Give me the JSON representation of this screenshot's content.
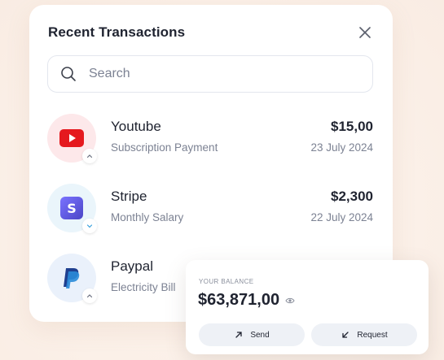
{
  "card": {
    "title": "Recent Transactions",
    "close_icon": "close-icon"
  },
  "search": {
    "placeholder": "Search",
    "value": "",
    "icon": "search-icon"
  },
  "transactions": [
    {
      "name": "Youtube",
      "description": "Subscription Payment",
      "amount": "$15,00",
      "date": "23 July 2024",
      "icon": "youtube-logo-icon",
      "direction": "up",
      "avatar_bg": "#fde8ea",
      "brand_color": "#e5191e"
    },
    {
      "name": "Stripe",
      "description": "Monthly Salary",
      "amount": "$2,300",
      "date": "22 July 2024",
      "icon": "stripe-logo-icon",
      "direction": "down",
      "avatar_bg": "#eaf5fb",
      "brand_color": "#6058dc"
    },
    {
      "name": "Paypal",
      "description": "Electricity Bill",
      "amount": "",
      "date": "",
      "icon": "paypal-logo-icon",
      "direction": "up",
      "avatar_bg": "#eaf1fb",
      "brand_color": "#1f3f8f"
    }
  ],
  "balance": {
    "label": "YOUR BALANCE",
    "amount": "$63,871,00",
    "eye_icon": "eye-icon",
    "send_label": "Send",
    "request_label": "Request"
  },
  "colors": {
    "background": "#fbf0e8",
    "text_primary": "#1f2330",
    "text_secondary": "#7c8293",
    "button_bg": "#eef1f6"
  }
}
